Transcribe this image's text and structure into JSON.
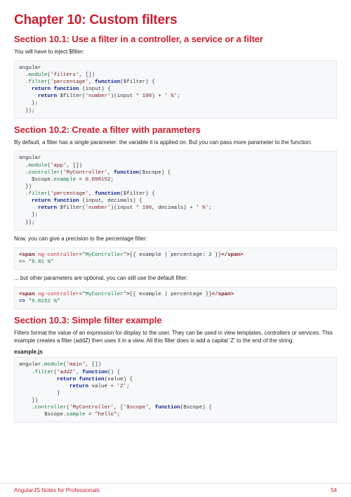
{
  "chapter_title": "Chapter 10: Custom filters",
  "section1": {
    "heading": "Section 10.1: Use a filter in a controller, a service or a filter",
    "intro": "You will have to inject $filter:"
  },
  "section2": {
    "heading": "Section 10.2: Create a filter with parameters",
    "intro": "By default, a filter has a single parameter: the variable it is applied on. But you can pass more parameter to the function:",
    "after1": "Now, you can give a precision to the percentage filter:",
    "after2": "... but other parameters are optional, you can still use the default filter:"
  },
  "section3": {
    "heading": "Section 10.3: Simple filter example",
    "intro": "Filters format the value of an expression for display to the user. They can be used in view templates, controllers or services. This example creates a filter (addZ) then uses it in a view. All this filter does is add a capital 'Z' to the end of the string.",
    "filename": "example.js"
  },
  "code": {
    "s1": {
      "l1a": "angular",
      "l2a": "  .",
      "l2b": "module",
      "l2c": "(",
      "l2d": "'filters'",
      "l2e": ", [])",
      "l3a": "  .",
      "l3b": "filter",
      "l3c": "(",
      "l3d": "'percentage'",
      "l3e": ", ",
      "l3f": "function",
      "l3g": "($filter) {",
      "l4a": "    ",
      "l4b": "return",
      "l4c": " ",
      "l4d": "function",
      "l4e": " (input) {",
      "l5a": "      ",
      "l5b": "return",
      "l5c": " $filter(",
      "l5d": "'number'",
      "l5e": ")(input * ",
      "l5f": "100",
      "l5g": ") + ",
      "l5h": "' %'",
      "l5i": ";",
      "l6a": "    };",
      "l7a": "  });"
    },
    "s2a": {
      "l1a": "angular",
      "l2a": "  .",
      "l2b": "module",
      "l2c": "(",
      "l2d": "'app'",
      "l2e": ", [])",
      "l3a": "  .",
      "l3b": "controller",
      "l3c": "(",
      "l3d": "'MyController'",
      "l3e": ", ",
      "l3f": "function",
      "l3g": "($scope) {",
      "l4a": "    $scope.",
      "l4b": "example",
      "l4c": " = ",
      "l4d": "0.098152",
      "l4e": ";",
      "l5a": "  })",
      "l6a": "  .",
      "l6b": "filter",
      "l6c": "(",
      "l6d": "'percentage'",
      "l6e": ", ",
      "l6f": "function",
      "l6g": "($filter) {",
      "l7a": "    ",
      "l7b": "return",
      "l7c": " ",
      "l7d": "function",
      "l7e": " (input, decimals) {",
      "l8a": "      ",
      "l8b": "return",
      "l8c": " $filter(",
      "l8d": "'number'",
      "l8e": ")(input * ",
      "l8f": "100",
      "l8g": ", decimals) + ",
      "l8h": "' %'",
      "l8i": ";",
      "l9a": "    };",
      "l10a": "  });"
    },
    "s2b": {
      "l1a": "<span",
      "l1b": " ",
      "l1c": "ng-controller",
      "l1d": "=",
      "l1e": "\"MyController\"",
      "l1f": ">",
      "l1g": "{{ example | percentage: 2 }}",
      "l1h": "</span>",
      "l2a": "=> ",
      "l2b": "\"9.81 %\""
    },
    "s2c": {
      "l1a": "<span",
      "l1b": " ",
      "l1c": "ng-controller",
      "l1d": "=",
      "l1e": "\"MyController\"",
      "l1f": ">",
      "l1g": "{{ example | percentage }}",
      "l1h": "</span>",
      "l2a": "=> ",
      "l2b": "\"9.8152 %\""
    },
    "s3": {
      "l1a": "angular.",
      "l1b": "module",
      "l1c": "(",
      "l1d": "'main'",
      "l1e": ", [])",
      "l2a": "    .",
      "l2b": "filter",
      "l2c": "(",
      "l2d": "'addZ'",
      "l2e": ", ",
      "l2f": "function",
      "l2g": "() {",
      "l3a": "            ",
      "l3b": "return",
      "l3c": " ",
      "l3d": "function",
      "l3e": "(value) {",
      "l4a": "                ",
      "l4b": "return",
      "l4c": " value + ",
      "l4d": "'Z'",
      "l4e": ";",
      "l5a": "            }",
      "l6a": "    })",
      "l7a": "    .",
      "l7b": "controller",
      "l7c": "(",
      "l7d": "'MyController'",
      "l7e": ", [",
      "l7f": "'$scope'",
      "l7g": ", ",
      "l7h": "function",
      "l7i": "($scope) {",
      "l8a": "        $scope.",
      "l8b": "sample",
      "l8c": " = ",
      "l8d": "\"hello\"",
      "l8e": ";"
    }
  },
  "footer": {
    "left": "AngularJS Notes for Professionals",
    "right": "54"
  }
}
